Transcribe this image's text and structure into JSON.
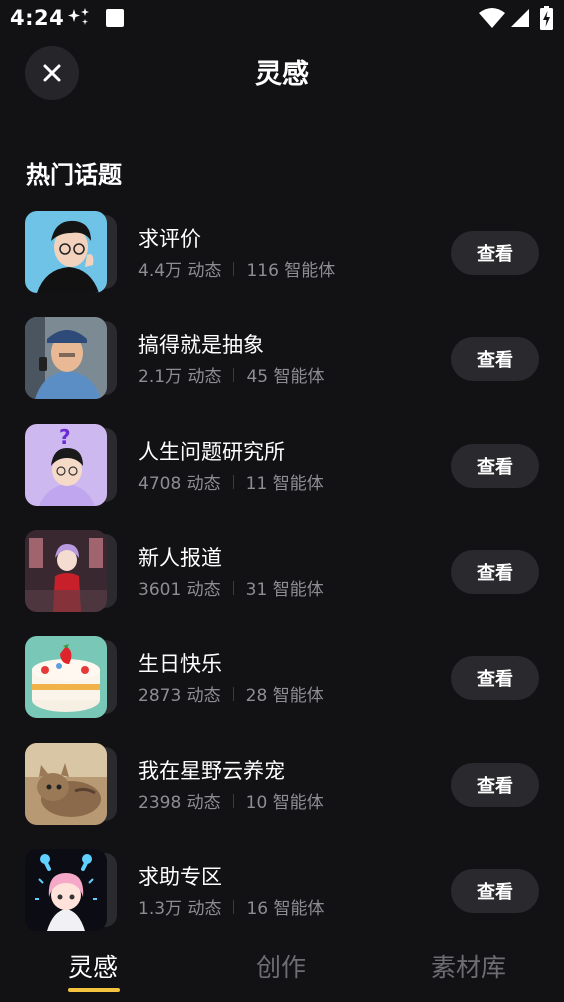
{
  "status_bar": {
    "time": "4:24"
  },
  "header": {
    "title": "灵感"
  },
  "section": {
    "title": "热门话题"
  },
  "topics": [
    {
      "title": "求评价",
      "posts": "4.4万 动态",
      "agents": "116 智能体",
      "action": "查看"
    },
    {
      "title": "搞得就是抽象",
      "posts": "2.1万 动态",
      "agents": "45 智能体",
      "action": "查看"
    },
    {
      "title": "人生问题研究所",
      "posts": "4708 动态",
      "agents": "11 智能体",
      "action": "查看"
    },
    {
      "title": "新人报道",
      "posts": "3601 动态",
      "agents": "31 智能体",
      "action": "查看"
    },
    {
      "title": "生日快乐",
      "posts": "2873 动态",
      "agents": "28 智能体",
      "action": "查看"
    },
    {
      "title": "我在星野云养宠",
      "posts": "2398 动态",
      "agents": "10 智能体",
      "action": "查看"
    },
    {
      "title": "求助专区",
      "posts": "1.3万 动态",
      "agents": "16 智能体",
      "action": "查看"
    }
  ],
  "tabs": [
    {
      "label": "灵感",
      "active": true
    },
    {
      "label": "创作",
      "active": false
    },
    {
      "label": "素材库",
      "active": false
    }
  ],
  "colors": {
    "background": "#121215",
    "button": "#2a2a2e",
    "tab_indicator": "#f3c33f",
    "meta_text": "#8d8d93"
  }
}
